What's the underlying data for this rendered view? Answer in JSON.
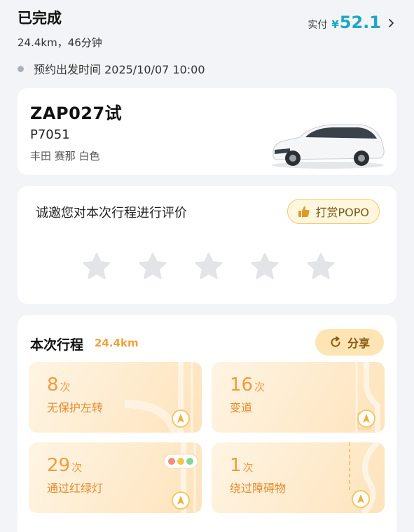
{
  "header": {
    "status": "已完成",
    "summary": "24.4km，46分钟",
    "fare_label": "实付",
    "currency": "¥",
    "amount": "52.1"
  },
  "schedule": "预约出发时间 2025/10/07 10:00",
  "vehicle": {
    "plate": "ZAP027试",
    "code": "P7051",
    "description": "丰田 赛那 白色"
  },
  "rating": {
    "prompt": "诚邀您对本次行程进行评价",
    "tip_label": "打赏POPO",
    "stars": 5
  },
  "trip": {
    "title": "本次行程",
    "distance": "24.4km",
    "share_label": "分享",
    "stats": [
      {
        "count": "8",
        "unit": "次",
        "label": "无保护左转"
      },
      {
        "count": "16",
        "unit": "次",
        "label": "变道"
      },
      {
        "count": "29",
        "unit": "次",
        "label": "通过红绿灯"
      },
      {
        "count": "1",
        "unit": "次",
        "label": "绕过障碍物"
      }
    ]
  },
  "colors": {
    "accent": "#1ba8c8",
    "stat_orange": "#f29a3a",
    "tip_border": "#f4c868"
  }
}
